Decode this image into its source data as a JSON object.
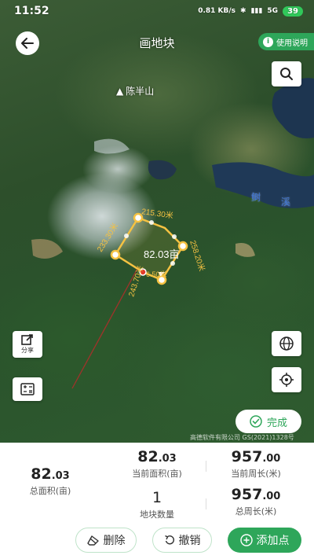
{
  "status_bar": {
    "time": "11:52",
    "network_speed": "0.81 KB/s",
    "network": "5G",
    "battery": "39"
  },
  "header": {
    "title": "画地块",
    "help_label": "使用说明"
  },
  "map": {
    "place_label": "陈半山",
    "water_label_1": "鲥",
    "water_label_2": "溪",
    "center_area_label": "82.03亩",
    "edge_labels": [
      "215.30米",
      "233.30米",
      "258.20米",
      "243.70米",
      "6.50米"
    ],
    "share_label": "分享",
    "done_label": "完成",
    "attribution": "高德软件有限公司 GS(2021)1328号"
  },
  "stats": {
    "total_area": {
      "int": "82",
      "dec": ".03",
      "caption": "总面积(亩)"
    },
    "current_area": {
      "int": "82",
      "dec": ".03",
      "caption": "当前面积(亩)"
    },
    "current_perimeter": {
      "int": "957",
      "dec": ".00",
      "caption": "当前周长(米)"
    },
    "plot_count": {
      "value": "1",
      "caption": "地块数量"
    },
    "total_perimeter": {
      "int": "957",
      "dec": ".00",
      "caption": "总周长(米)"
    }
  },
  "actions": {
    "delete_label": "删除",
    "undo_label": "撤销",
    "add_point_label": "添加点"
  },
  "colors": {
    "accent": "#2ea65a",
    "polygon": "#f5c242",
    "line": "#a0322a"
  }
}
